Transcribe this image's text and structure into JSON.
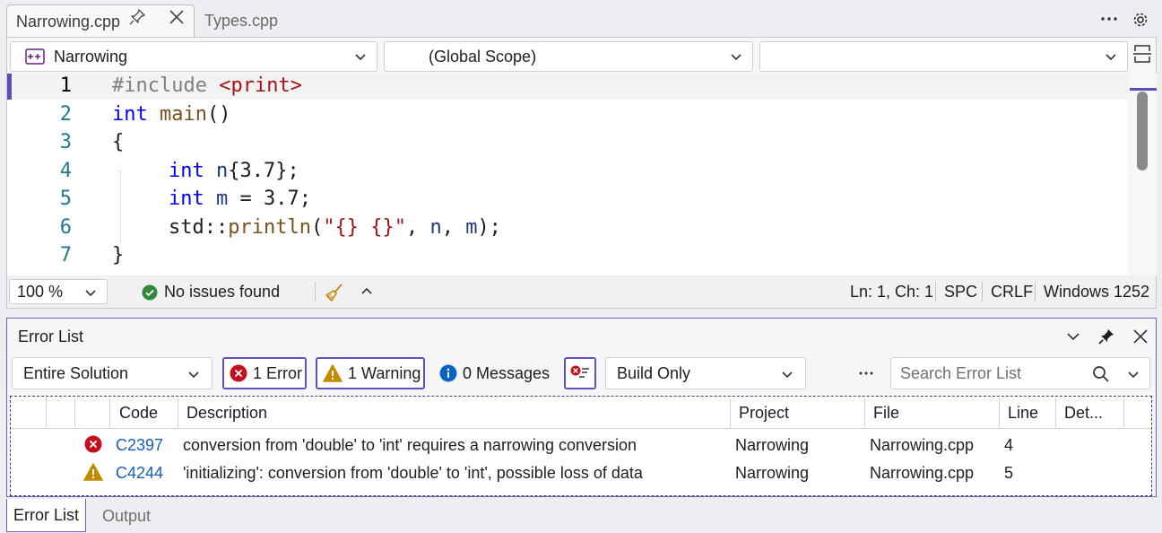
{
  "editor": {
    "tabs": [
      {
        "label": "Narrowing.cpp",
        "active": true
      },
      {
        "label": "Types.cpp",
        "active": false
      }
    ],
    "nav": {
      "project": "Narrowing",
      "scope": "(Global Scope)",
      "member": ""
    },
    "line_numbers": [
      "1",
      "2",
      "3",
      "4",
      "5",
      "6",
      "7"
    ],
    "code": {
      "l1_directive": "#include",
      "l1_header": "<print>",
      "l2_kw": "int",
      "l2_fn": "main",
      "l2_rest": "()",
      "l3": "{",
      "l4_kw": "int",
      "l4_var": "n",
      "l4_rest": "{3.7};",
      "l5_kw": "int",
      "l5_var": "m",
      "l5_rest": " = 3.7;",
      "l6_ns": "std",
      "l6_sep": "::",
      "l6_fn": "println",
      "l6_open": "(",
      "l6_str": "\"{} {}\"",
      "l6_comma1": ", ",
      "l6_n": "n",
      "l6_comma2": ", ",
      "l6_m": "m",
      "l6_close": ");",
      "l7": "}"
    },
    "status": {
      "zoom": "100 %",
      "issues": "No issues found",
      "position": "Ln: 1, Ch: 1",
      "whitespace": "SPC",
      "line_ending": "CRLF",
      "encoding": "Windows 1252"
    }
  },
  "error_list": {
    "title": "Error List",
    "scope": "Entire Solution",
    "errors_label": "1 Error",
    "warnings_label": "1 Warning",
    "messages_label": "0 Messages",
    "build_filter": "Build Only",
    "search_placeholder": "Search Error List",
    "columns": {
      "code": "Code",
      "description": "Description",
      "project": "Project",
      "file": "File",
      "line": "Line",
      "details": "Det..."
    },
    "rows": [
      {
        "severity": "error",
        "code": "C2397",
        "description": "conversion from 'double' to 'int' requires a narrowing conversion",
        "project": "Narrowing",
        "file": "Narrowing.cpp",
        "line": "4"
      },
      {
        "severity": "warning",
        "code": "C4244",
        "description": "'initializing': conversion from 'double' to 'int', possible loss of data",
        "project": "Narrowing",
        "file": "Narrowing.cpp",
        "line": "5"
      }
    ]
  },
  "bottom_tabs": [
    {
      "label": "Error List",
      "active": true
    },
    {
      "label": "Output",
      "active": false
    }
  ],
  "colors": {
    "accent": "#6b62c4",
    "error": "#c50f1f",
    "warning": "#c28a00",
    "info": "#0a64c8",
    "success": "#2f8a3a",
    "keyword": "#0000ff",
    "string": "#a31515",
    "function": "#74531f"
  },
  "icons": [
    "pin-icon",
    "close-icon",
    "more-icon",
    "gear-icon",
    "cpp-project-icon",
    "chevron-down-icon",
    "split-editor-icon",
    "check-circle-icon",
    "broom-icon",
    "chevron-up-icon",
    "error-icon",
    "warning-icon",
    "info-icon",
    "filter-icon",
    "search-icon"
  ]
}
